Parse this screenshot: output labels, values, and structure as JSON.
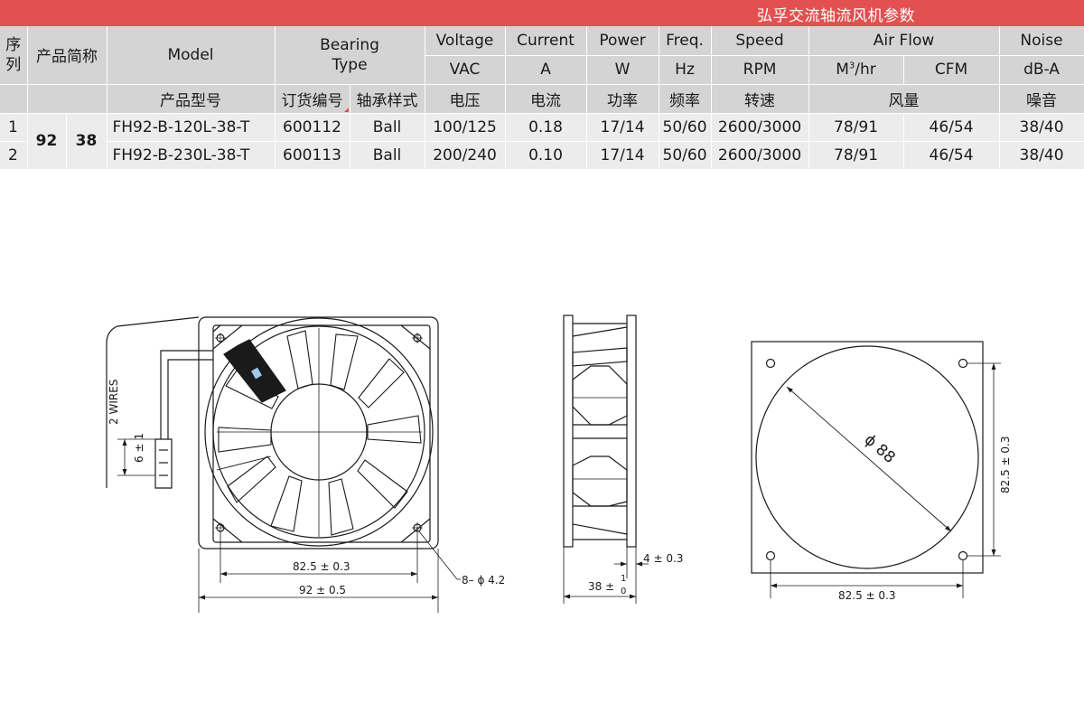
{
  "banner": {
    "title": "弘孚交流轴流风机参数"
  },
  "table": {
    "h_index": "序列",
    "h_abbr": "产品简称",
    "h_model_en": "Model",
    "h_model_cn": "产品型号",
    "h_order_cn": "订货编号",
    "h_bearing_en": "Bearing Type",
    "h_bearing_cn": "轴承样式",
    "h_voltage_en": "Voltage",
    "h_voltage_unit": "VAC",
    "h_voltage_cn": "电压",
    "h_current_en": "Current",
    "h_current_unit": "A",
    "h_current_cn": "电流",
    "h_power_en": "Power",
    "h_power_unit": "W",
    "h_power_cn": "功率",
    "h_freq_en": "Freq.",
    "h_freq_unit": "Hz",
    "h_freq_cn": "频率",
    "h_speed_en": "Speed",
    "h_speed_unit": "RPM",
    "h_speed_cn": "转速",
    "h_airflow_en": "Air Flow",
    "h_airflow_unit1": "M",
    "h_airflow_sup": "3",
    "h_airflow_unit1b": "/hr",
    "h_airflow_unit2": "CFM",
    "h_airflow_cn": "风量",
    "h_noise_en": "Noise",
    "h_noise_unit": "dB-A",
    "h_noise_cn": "噪音",
    "size": "92",
    "thickness": "38",
    "rows": [
      {
        "index": "1",
        "model": "FH92-B-120L-38-T",
        "order": "600112",
        "bearing": "Ball",
        "voltage": "100/125",
        "current": "0.18",
        "power": "17/14",
        "freq": "50/60",
        "speed": "2600/3000",
        "m3hr": "78/91",
        "cfm": "46/54",
        "noise": "38/40"
      },
      {
        "index": "2",
        "model": "FH92-B-230L-38-T",
        "order": "600113",
        "bearing": "Ball",
        "voltage": "200/240",
        "current": "0.10",
        "power": "17/14",
        "freq": "50/60",
        "speed": "2600/3000",
        "m3hr": "78/91",
        "cfm": "46/54",
        "noise": "38/40"
      }
    ]
  },
  "drawing": {
    "wires_label": "2 WIRES",
    "wire_dim": "6 ± 1",
    "front_hole_pitch": "82.5 ± 0.3",
    "front_width": "92 ± 0.5",
    "hole_callout": "8– ϕ 4.2",
    "side_flange": "4 ± 0.3",
    "side_depth": "38 ±",
    "side_tol_upper": "1",
    "side_tol_lower": "0",
    "back_diameter": "ϕ 88",
    "back_pitch_v": "82.5 ± 0.3",
    "back_pitch_h": "82.5 ± 0.3"
  }
}
